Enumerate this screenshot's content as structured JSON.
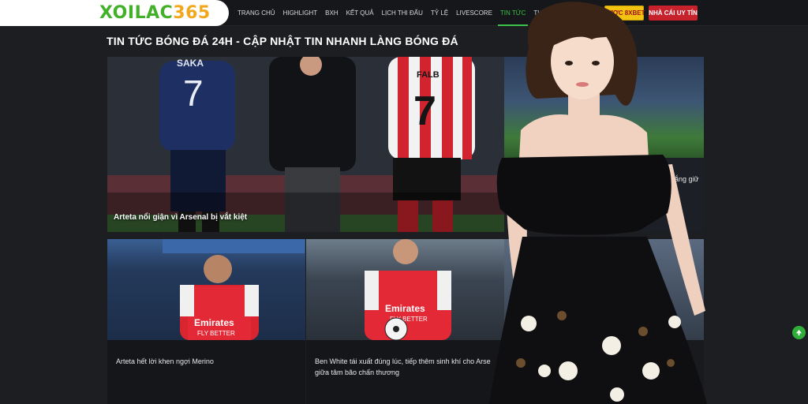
{
  "logo": {
    "part1": "XOILAC",
    "part2": "365"
  },
  "nav": {
    "items": [
      {
        "label": "Trang chủ"
      },
      {
        "label": "Highlight"
      },
      {
        "label": "BXH"
      },
      {
        "label": "Kết quả"
      },
      {
        "label": "Lịch thi đấu"
      },
      {
        "label": "Tỷ lệ"
      },
      {
        "label": "Livescore"
      },
      {
        "label": "Tin tức",
        "active": true
      },
      {
        "label": "Tuyển dụng"
      }
    ]
  },
  "buttons": {
    "cuoc8xbet": "CƯỢC 8XBET",
    "nhacai": "NHÀ CÁI UY TÍN"
  },
  "section": {
    "title": "TIN TỨC BÓNG ĐÁ 24H - CẬP NHẬT TIN NHANH LÀNG BÓNG ĐÁ"
  },
  "featured": {
    "title": "Arteta nổi giận vì Arsenal bị vắt kiệt",
    "shirt_left_name": "SAKA",
    "shirt_left_number": "7",
    "shirt_right_name": "FALB",
    "shirt_right_number": "7"
  },
  "side": {
    "title": "cố gắng giữ"
  },
  "cards": [
    {
      "text": "Arteta hết lời khen ngợi Merino",
      "sponsor": "Emirates",
      "sponsor2": "FLY BETTER"
    },
    {
      "text": "Ben White tái xuất đúng lúc, tiếp thêm sinh khí cho Arse giữa tâm bão chấn thương",
      "sponsor": "Emirates",
      "sponsor2": "FLY BETTER"
    },
    {
      "text": ""
    }
  ],
  "colors": {
    "accent": "#3ec14a",
    "header_bg": "#15171a",
    "page_bg": "#1c1e22",
    "gold": "#f2c411",
    "red": "#c7212c"
  },
  "icons": {
    "scroll_top": "arrow-up-icon"
  }
}
